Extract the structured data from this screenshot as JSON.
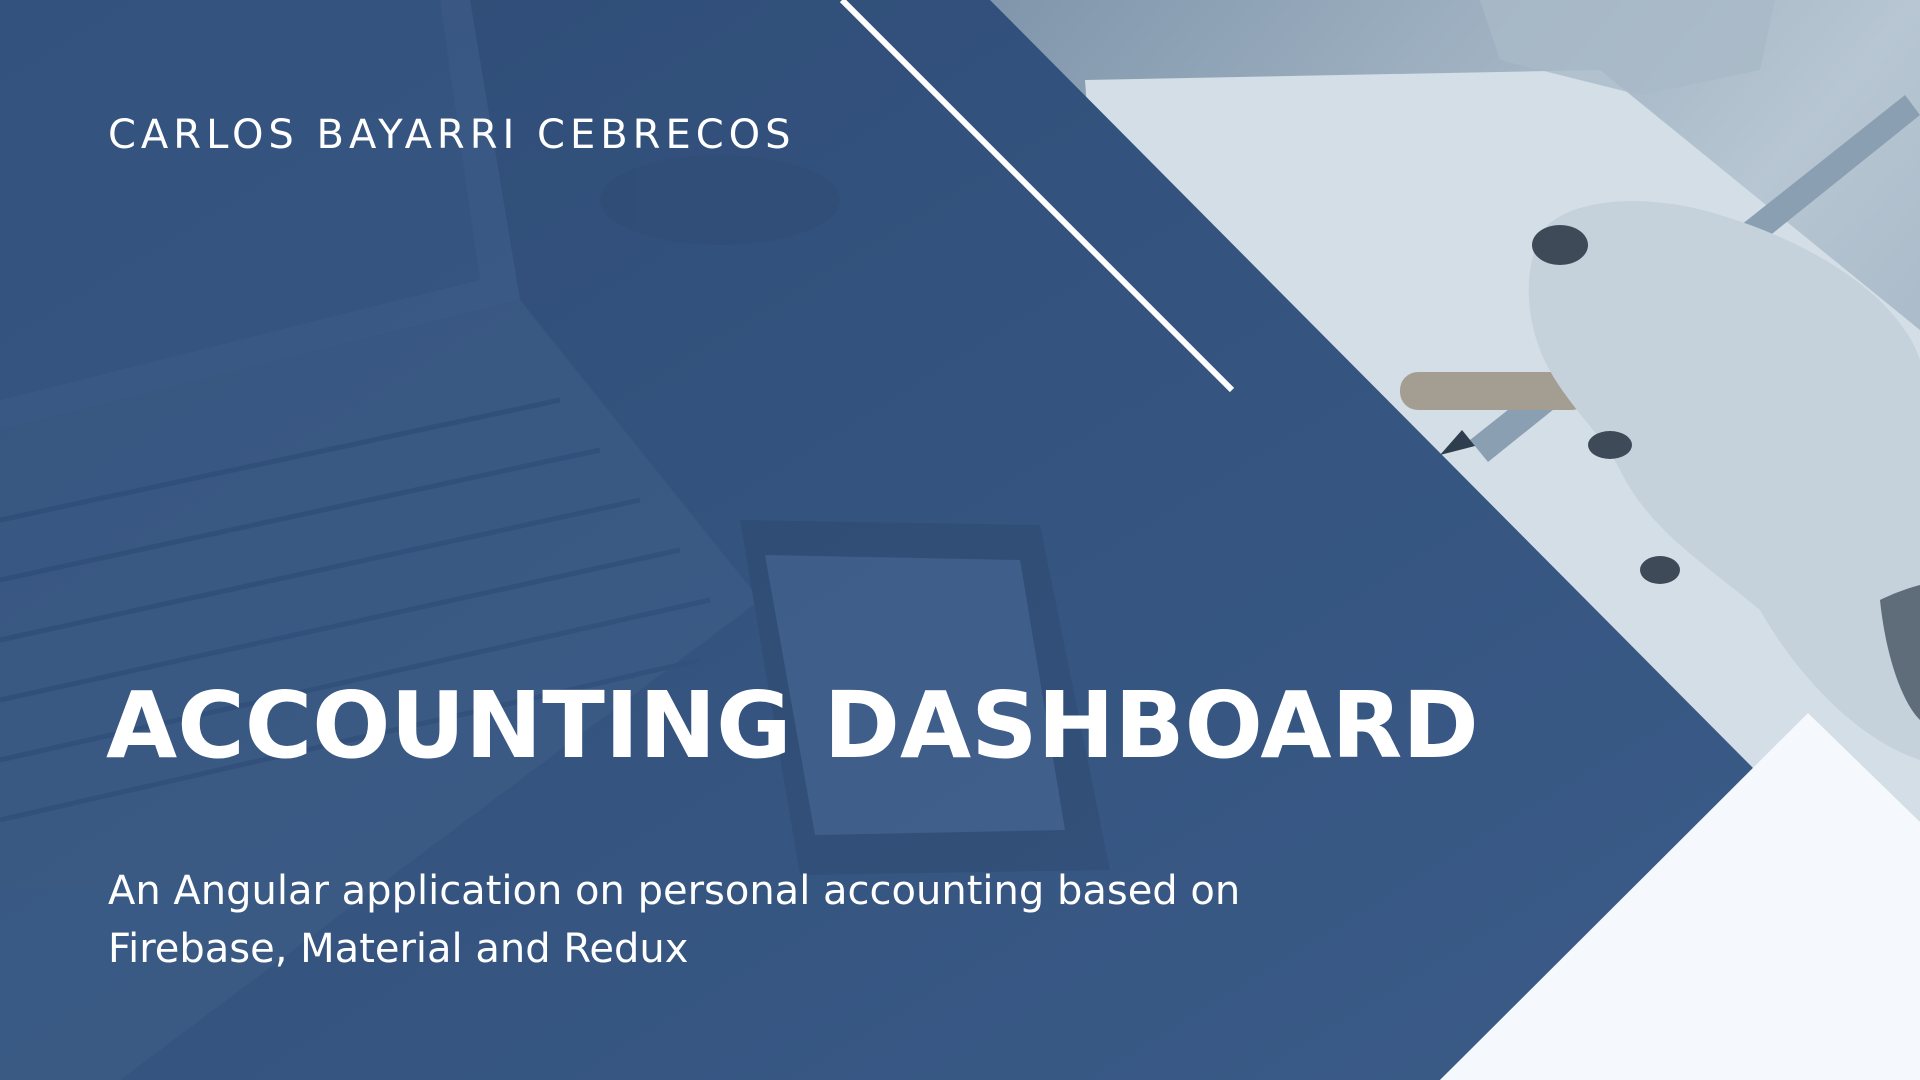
{
  "banner": {
    "author": "CARLOS BAYARRI CEBRECOS",
    "title": "ACCOUNTING DASHBOARD",
    "subtitle_line1": "An Angular application on personal accounting based on",
    "subtitle_line2": "Firebase, Material and Redux"
  },
  "colors": {
    "panel_blue": "#375783",
    "photo_tint": "#9fb2c4",
    "corner_white": "#f5f8fc",
    "text": "#ffffff"
  },
  "decorations": {
    "background_photo": "laptop-and-phone-on-desk-photo",
    "right_photo": "hand-writing-with-pen-photo",
    "diagonal_line": "white-diagonal-line",
    "corner_triangle": "white-corner-triangle"
  }
}
